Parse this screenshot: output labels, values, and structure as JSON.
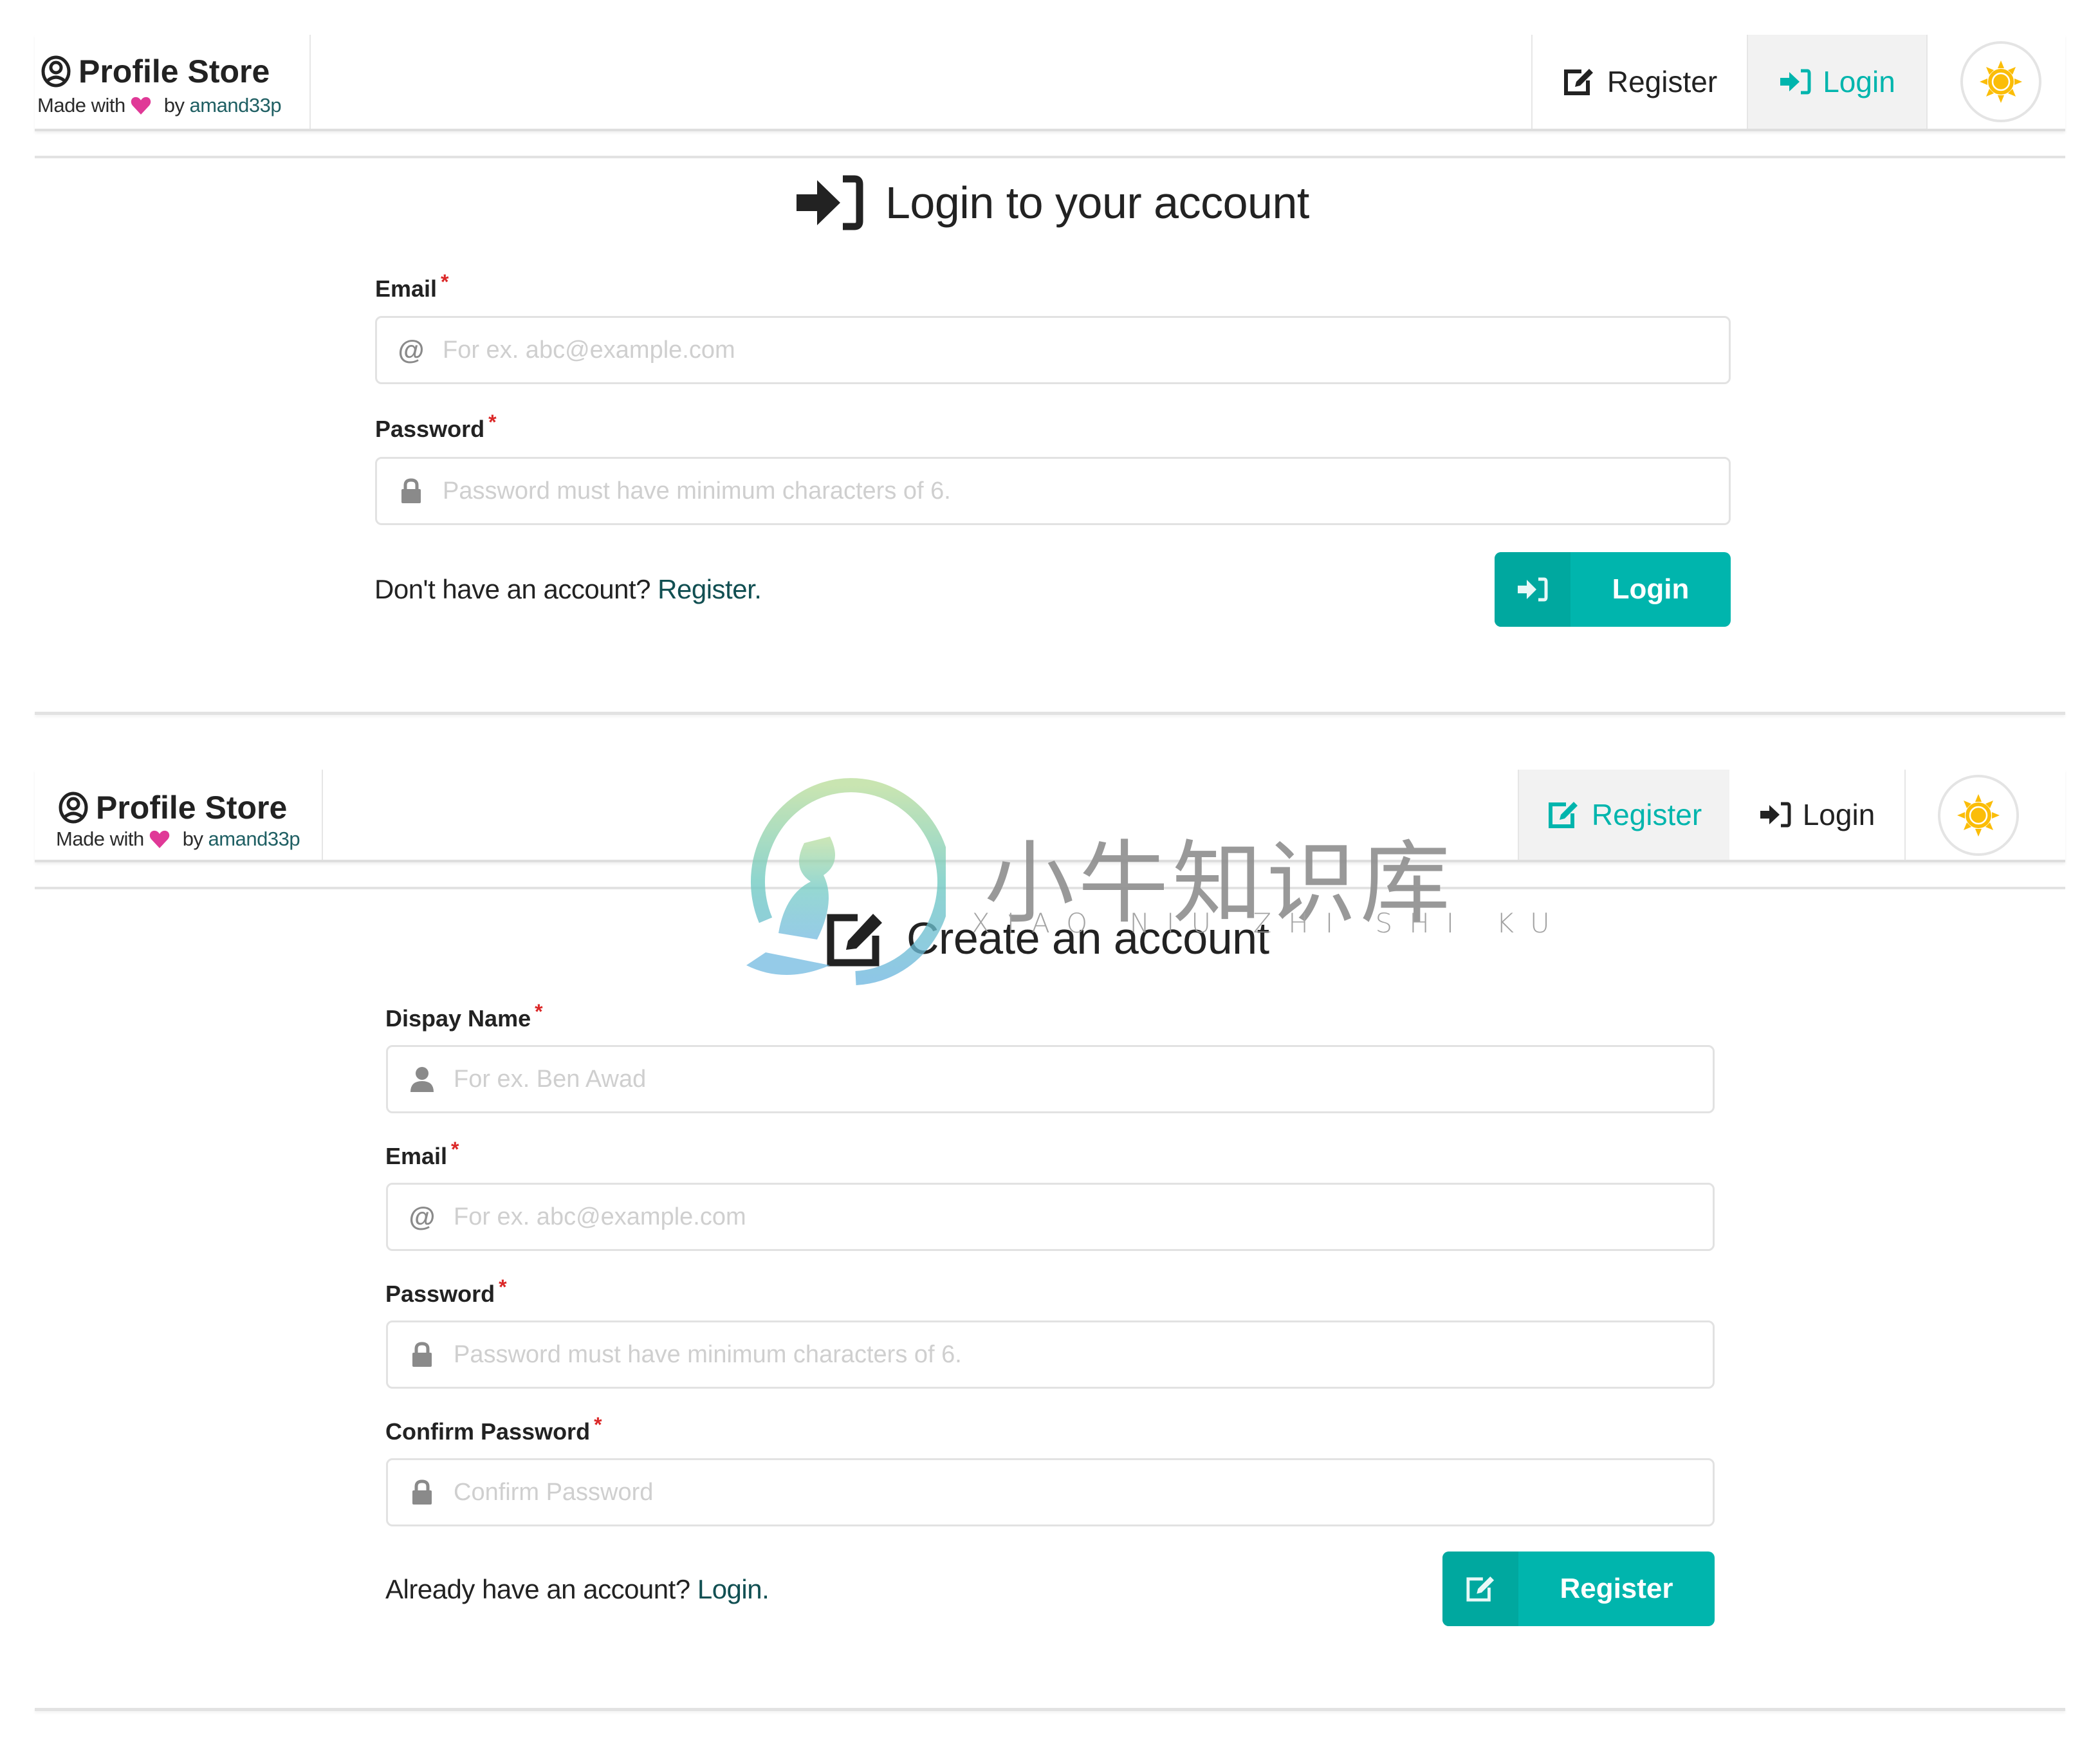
{
  "app": {
    "brand_title": "Profile Store",
    "made_with": "Made with",
    "by": "by",
    "author": "amand33p"
  },
  "colors": {
    "accent": "#00b5ad",
    "accent_dark": "#00a89f",
    "required": "#db2828",
    "heart": "#e03997",
    "sun": "#fbbd08",
    "link": "#114f52"
  },
  "panels": [
    {
      "nav": {
        "register_label": "Register",
        "login_label": "Login",
        "active": "login",
        "theme_icon": "sun-icon"
      },
      "title": "Login to your account",
      "title_icon": "sign-in-icon",
      "fields": [
        {
          "label": "Email",
          "required": "*",
          "icon": "at-icon",
          "placeholder": "For ex. abc@example.com",
          "value": ""
        },
        {
          "label": "Password",
          "required": "*",
          "icon": "lock-icon",
          "placeholder": "Password must have minimum characters of 6.",
          "value": ""
        }
      ],
      "footer": {
        "prompt": "Don't have an account?",
        "link": "Register."
      },
      "submit": {
        "label": "Login",
        "icon": "sign-in-icon"
      }
    },
    {
      "nav": {
        "register_label": "Register",
        "login_label": "Login",
        "active": "register",
        "theme_icon": "sun-icon"
      },
      "title": "Create an account",
      "title_icon": "edit-icon",
      "fields": [
        {
          "label": "Dispay Name",
          "required": "*",
          "icon": "user-icon",
          "placeholder": "For ex. Ben Awad",
          "value": ""
        },
        {
          "label": "Email",
          "required": "*",
          "icon": "at-icon",
          "placeholder": "For ex. abc@example.com",
          "value": ""
        },
        {
          "label": "Password",
          "required": "*",
          "icon": "lock-icon",
          "placeholder": "Password must have minimum characters of 6.",
          "value": ""
        },
        {
          "label": "Confirm Password",
          "required": "*",
          "icon": "lock-icon",
          "placeholder": "Confirm Password",
          "value": ""
        }
      ],
      "footer": {
        "prompt": "Already have an account?",
        "link": "Login."
      },
      "submit": {
        "label": "Register",
        "icon": "edit-icon"
      }
    }
  ],
  "watermark": {
    "chinese": "小牛知识库",
    "pinyin": "XIAO NIU ZHI SHI KU"
  }
}
